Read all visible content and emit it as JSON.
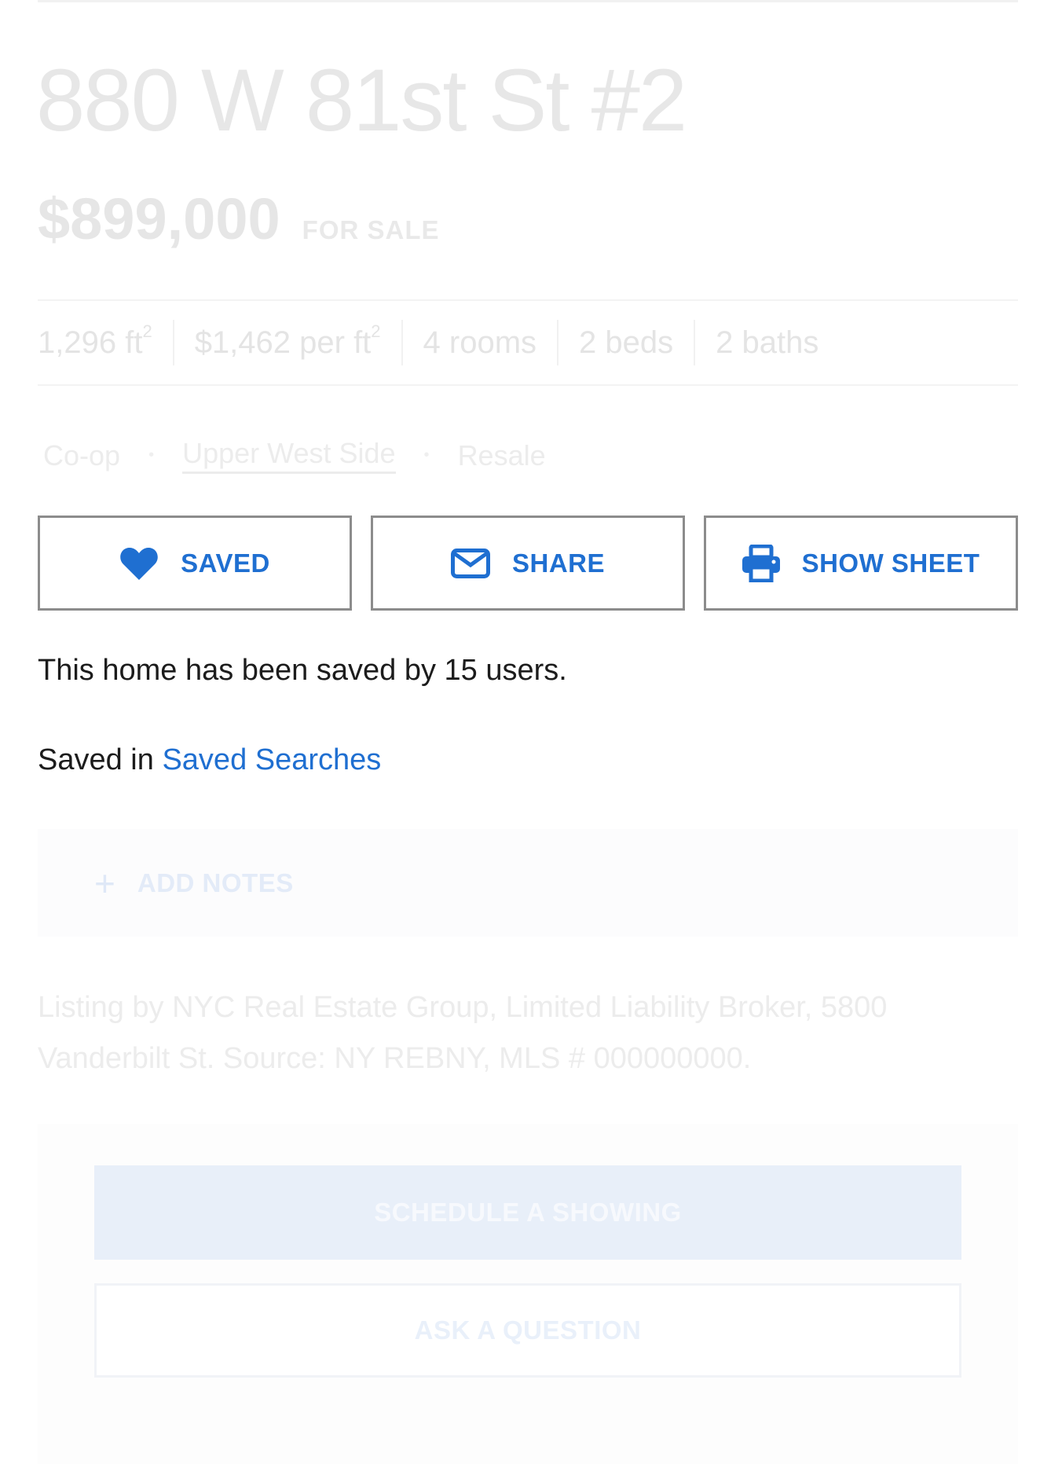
{
  "listing": {
    "address": "880 W 81st St #2",
    "price": "$899,000",
    "status": "FOR SALE"
  },
  "stats": {
    "area_value": "1,296 ft",
    "area_sup": "2",
    "price_per_value": "$1,462 per ft",
    "price_per_sup": "2",
    "rooms": "4 rooms",
    "beds": "2 beds",
    "baths": "2 baths"
  },
  "tags": {
    "type": "Co-op",
    "neighborhood": "Upper West Side",
    "sale_type": "Resale",
    "separator": "•"
  },
  "actions": {
    "saved_label": "SAVED",
    "share_label": "SHARE",
    "sheet_label": "SHOW SHEET"
  },
  "saved_info": {
    "count_text": "This home has been saved by 15 users.",
    "saved_in_prefix": "Saved in",
    "saved_in_link": "Saved Searches"
  },
  "notes": {
    "plus": "+",
    "label": "ADD NOTES"
  },
  "listing_info": "Listing by NYC Real Estate Group, Limited Liability Broker, 5800 Vanderbilt St. Source: NY REBNY, MLS # 000000000.",
  "cta": {
    "schedule_label": "SCHEDULE A SHOWING",
    "ask_label": "ASK A QUESTION"
  },
  "colors": {
    "accent": "#1f6fd1",
    "button_border": "#8c8c8c"
  },
  "icons": {
    "saved": "heart-icon",
    "share": "envelope-icon",
    "sheet": "printer-icon",
    "notes": "plus-icon"
  }
}
